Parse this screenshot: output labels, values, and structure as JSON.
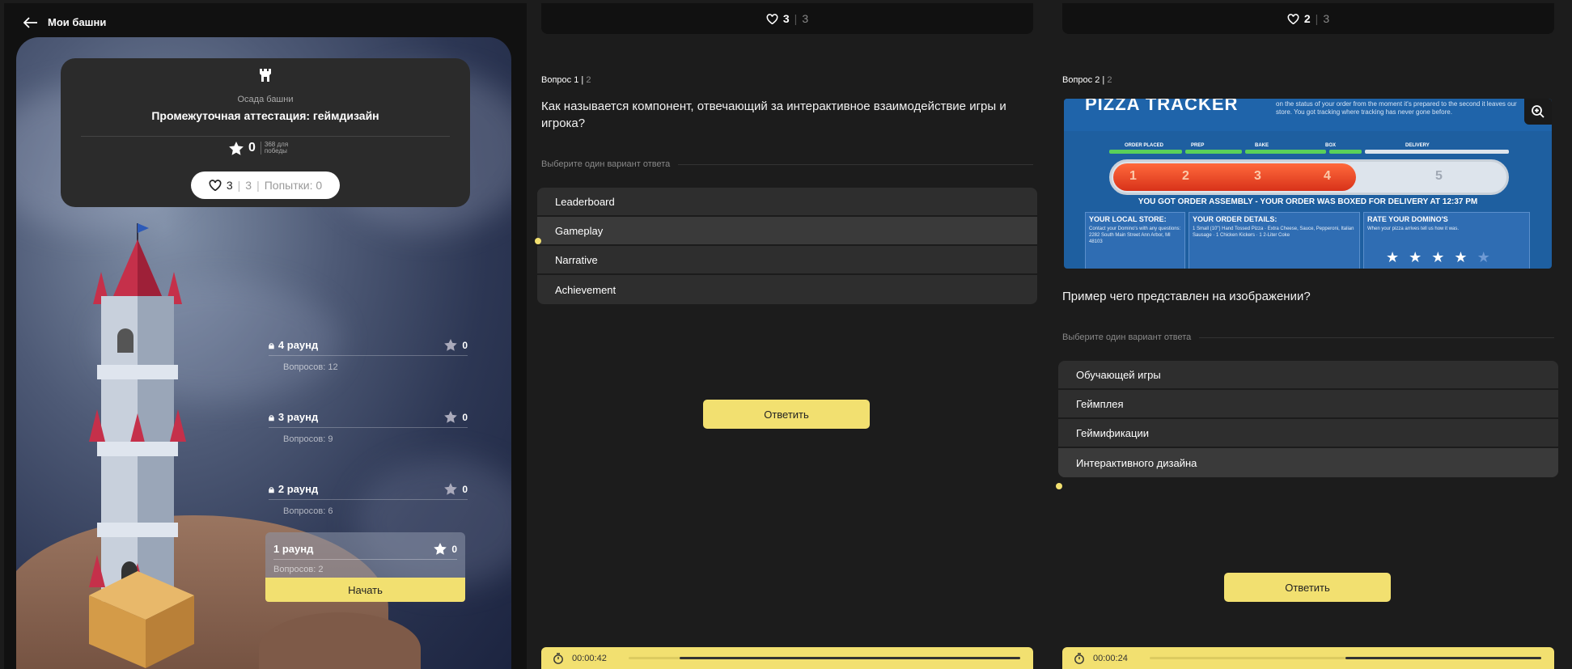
{
  "nav": {
    "back_label": "Мои башни"
  },
  "tower_info": {
    "subtitle": "Осада башни",
    "title": "Промежуточная аттестация: геймдизайн",
    "score": "0",
    "score_label": "368 для победы",
    "lives_current": "3",
    "lives_max": "3",
    "attempts": "Попытки: 0"
  },
  "rounds": [
    {
      "title": "4 раунд",
      "stars": "0",
      "questions": "Вопросов: 12",
      "locked": true
    },
    {
      "title": "3 раунд",
      "stars": "0",
      "questions": "Вопросов: 9",
      "locked": true
    },
    {
      "title": "2 раунд",
      "stars": "0",
      "questions": "Вопросов: 6",
      "locked": true
    },
    {
      "title": "1 раунд",
      "stars": "0",
      "questions": "Вопросов: 2",
      "locked": false
    }
  ],
  "start_button": "Начать",
  "quiz1": {
    "lives_current": "3",
    "lives_max": "3",
    "question_num": "Вопрос 1",
    "question_total": "2",
    "question": "Как называется компонент, отвечающий за интерактивное взаимодействие игры и игрока?",
    "choose_label": "Выберите один вариант ответа",
    "options": [
      "Leaderboard",
      "Gameplay",
      "Narrative",
      "Achievement"
    ],
    "selected_index": 1,
    "answer_button": "Ответить",
    "timer": "00:00:42",
    "timer_progress": 0.87
  },
  "quiz2": {
    "lives_current": "2",
    "lives_max": "3",
    "question_num": "Вопрос 2",
    "question_total": "2",
    "question": "Пример чего представлен на изображении?",
    "choose_label": "Выберите один вариант ответа",
    "options": [
      "Обучающей игры",
      "Геймплея",
      "Геймификации",
      "Интерактивного дизайна"
    ],
    "selected_index": 3,
    "answer_button": "Ответить",
    "timer": "00:00:24",
    "timer_progress": 0.5,
    "image": {
      "brand": "PIZZA TRACKER",
      "tagline": "on the status of your order from the moment it's prepared to the second it leaves our store. You got tracking where tracking has never gone before.",
      "stages": [
        "ORDER PLACED",
        "PREP",
        "BAKE",
        "BOX",
        "DELIVERY"
      ],
      "stage_numbers": [
        "1",
        "2",
        "3",
        "4",
        "5"
      ],
      "banner": "YOU GOT ORDER ASSEMBLY - YOUR ORDER WAS BOXED FOR DELIVERY AT 12:37 PM",
      "panels": [
        {
          "title": "YOUR LOCAL STORE:",
          "text": "Contact your Domino's with any questions: 2282 South Main Street Ann Arbor, MI 48103"
        },
        {
          "title": "YOUR ORDER DETAILS:",
          "text": "1 Small (10\") Hand Tossed Pizza · Extra Cheese, Sauce, Pepperoni, Italian Sausage · 1 Chicken Kickers · 1 2-Liter Coke"
        },
        {
          "title": "RATE YOUR DOMINO'S",
          "text": "When your pizza arrives tell us how it was."
        }
      ],
      "rating_stars": 4
    }
  },
  "colors": {
    "accent": "#f2e070",
    "bg": "#1c1c1c",
    "panel": "#2e2e2e"
  }
}
